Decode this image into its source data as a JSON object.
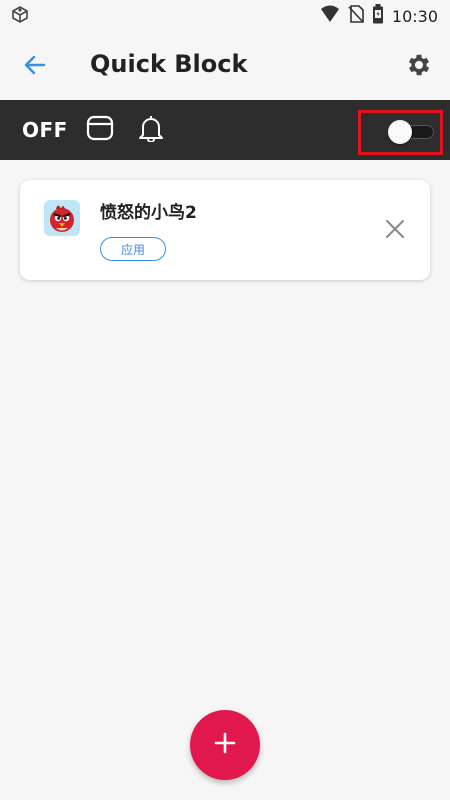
{
  "status_bar": {
    "time": "10:30",
    "icons": [
      "notification-app-icon",
      "wifi-icon",
      "no-sim-icon",
      "battery-icon"
    ]
  },
  "app_bar": {
    "title": "Quick Block",
    "back_icon": "arrow-left-icon",
    "settings_icon": "gear-icon"
  },
  "control_strip": {
    "state_label": "OFF",
    "icons": [
      "window-icon",
      "bell-icon"
    ],
    "toggle_on": false
  },
  "profiles": [
    {
      "app_name": "愤怒的小鸟2",
      "badge": "应用",
      "remove_icon": "close-icon"
    }
  ],
  "fab": {
    "icon": "plus-icon"
  },
  "colors": {
    "accent_blue": "#3a8ee6",
    "strip_bg": "#2d2d2d",
    "fab": "#e0184e",
    "highlight": "#e0141e"
  }
}
